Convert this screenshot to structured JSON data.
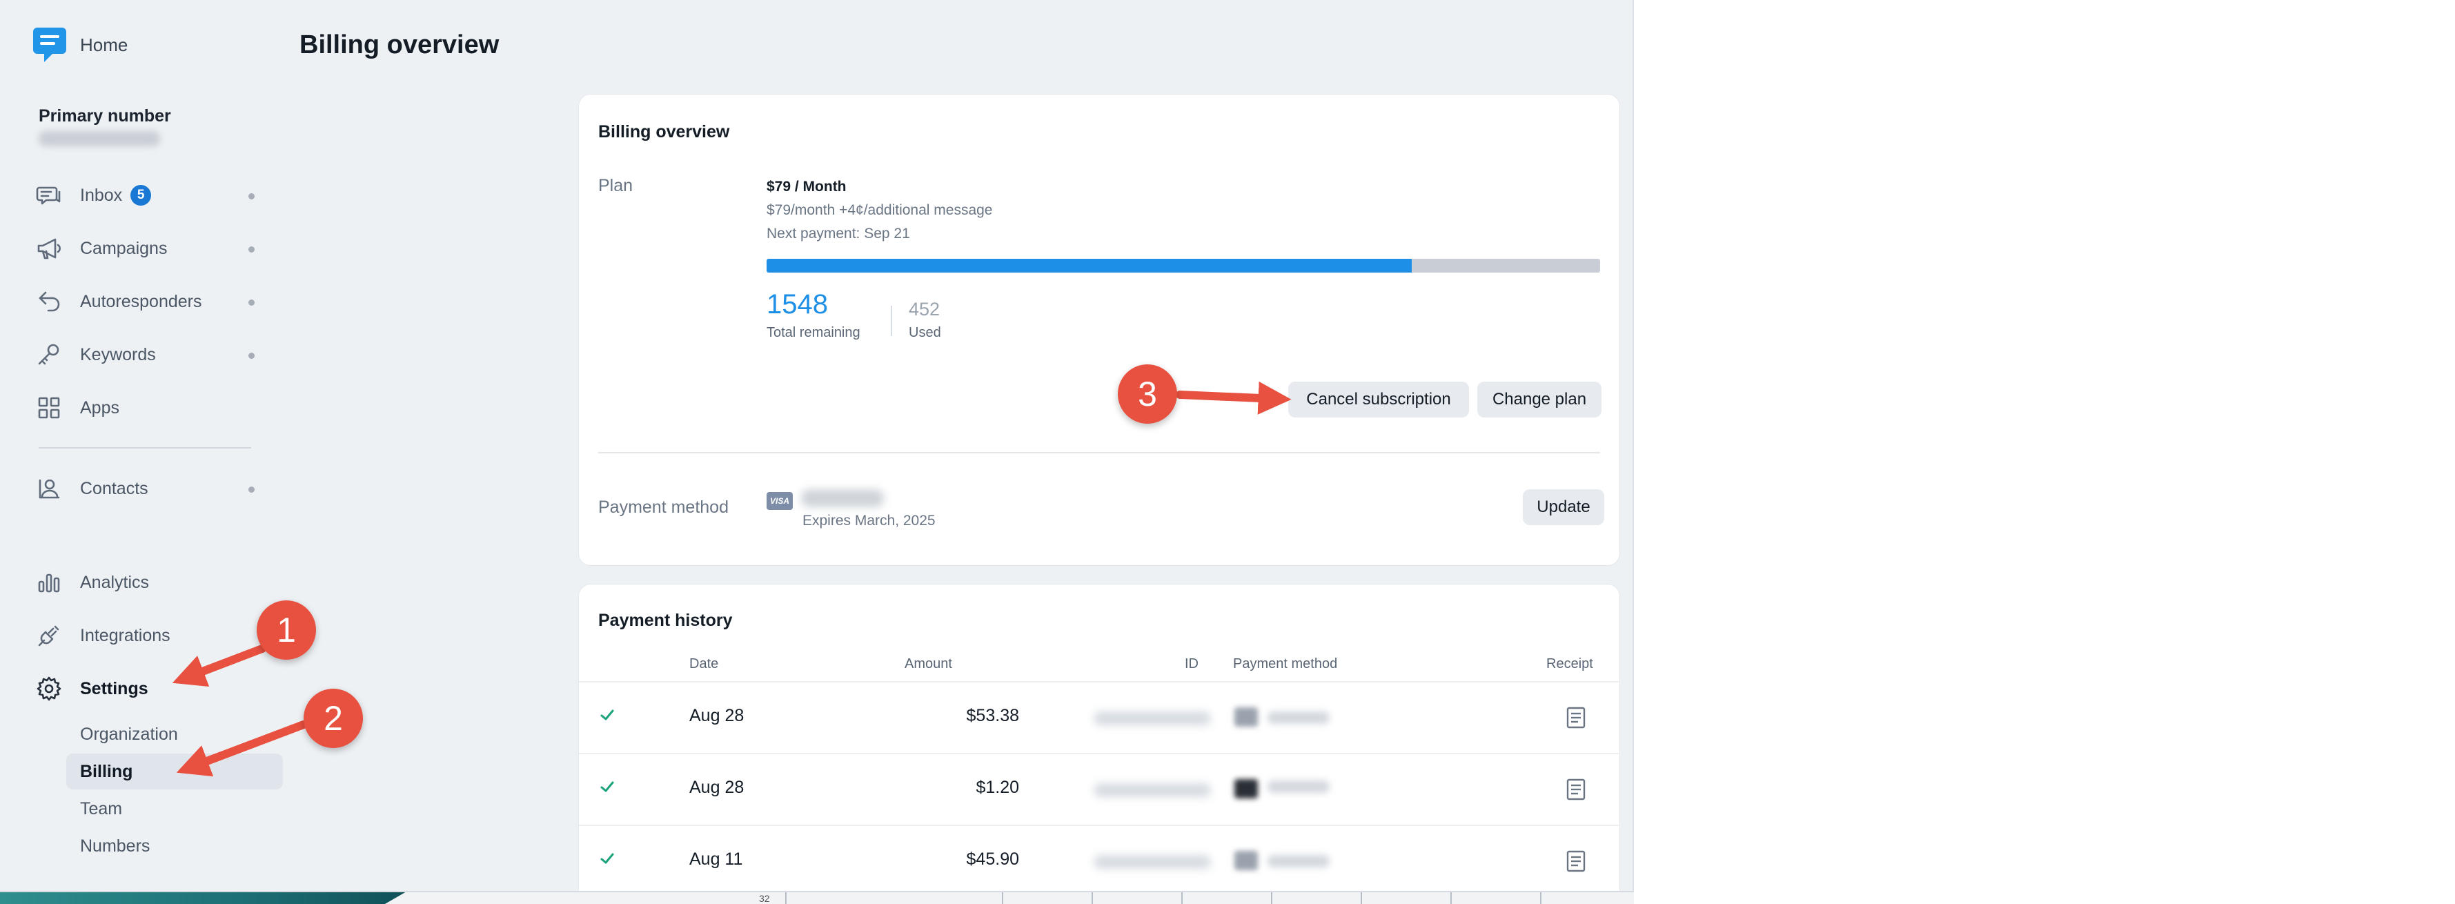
{
  "sidebar": {
    "home_label": "Home",
    "primary_number_title": "Primary number",
    "nav": {
      "inbox": "Inbox",
      "inbox_badge": "5",
      "campaigns": "Campaigns",
      "autoresponders": "Autoresponders",
      "keywords": "Keywords",
      "apps": "Apps",
      "contacts": "Contacts",
      "analytics": "Analytics",
      "integrations": "Integrations",
      "settings": "Settings"
    },
    "settings_sub": {
      "organization": "Organization",
      "billing": "Billing",
      "team": "Team",
      "numbers": "Numbers"
    }
  },
  "page": {
    "title": "Billing overview"
  },
  "overview_card": {
    "title": "Billing overview",
    "plan_label": "Plan",
    "plan_name": "$79 / Month",
    "plan_desc": "$79/month +4¢/additional message",
    "next_payment": "Next payment: Sep 21",
    "progress_fraction": 0.774,
    "remaining_value": "1548",
    "remaining_label": "Total remaining",
    "used_value": "452",
    "used_label": "Used",
    "cancel_button": "Cancel subscription",
    "change_plan_button": "Change plan",
    "payment_method_label": "Payment method",
    "card_brand": "VISA",
    "expires": "Expires March, 2025",
    "update_button": "Update"
  },
  "history_card": {
    "title": "Payment history",
    "columns": {
      "date": "Date",
      "amount": "Amount",
      "id": "ID",
      "payment_method": "Payment method",
      "receipt": "Receipt"
    },
    "rows": [
      {
        "date": "Aug 28",
        "amount": "$53.38"
      },
      {
        "date": "Aug 28",
        "amount": "$1.20"
      },
      {
        "date": "Aug 11",
        "amount": "$45.90"
      }
    ]
  },
  "annotations": {
    "step1": "1",
    "step2": "2",
    "step3": "3"
  },
  "background": {
    "row_number": "32"
  },
  "colors": {
    "accent": "#1e8fe6",
    "callout": "#e8503f",
    "success": "#1aa37a",
    "badge": "#1878d4"
  }
}
